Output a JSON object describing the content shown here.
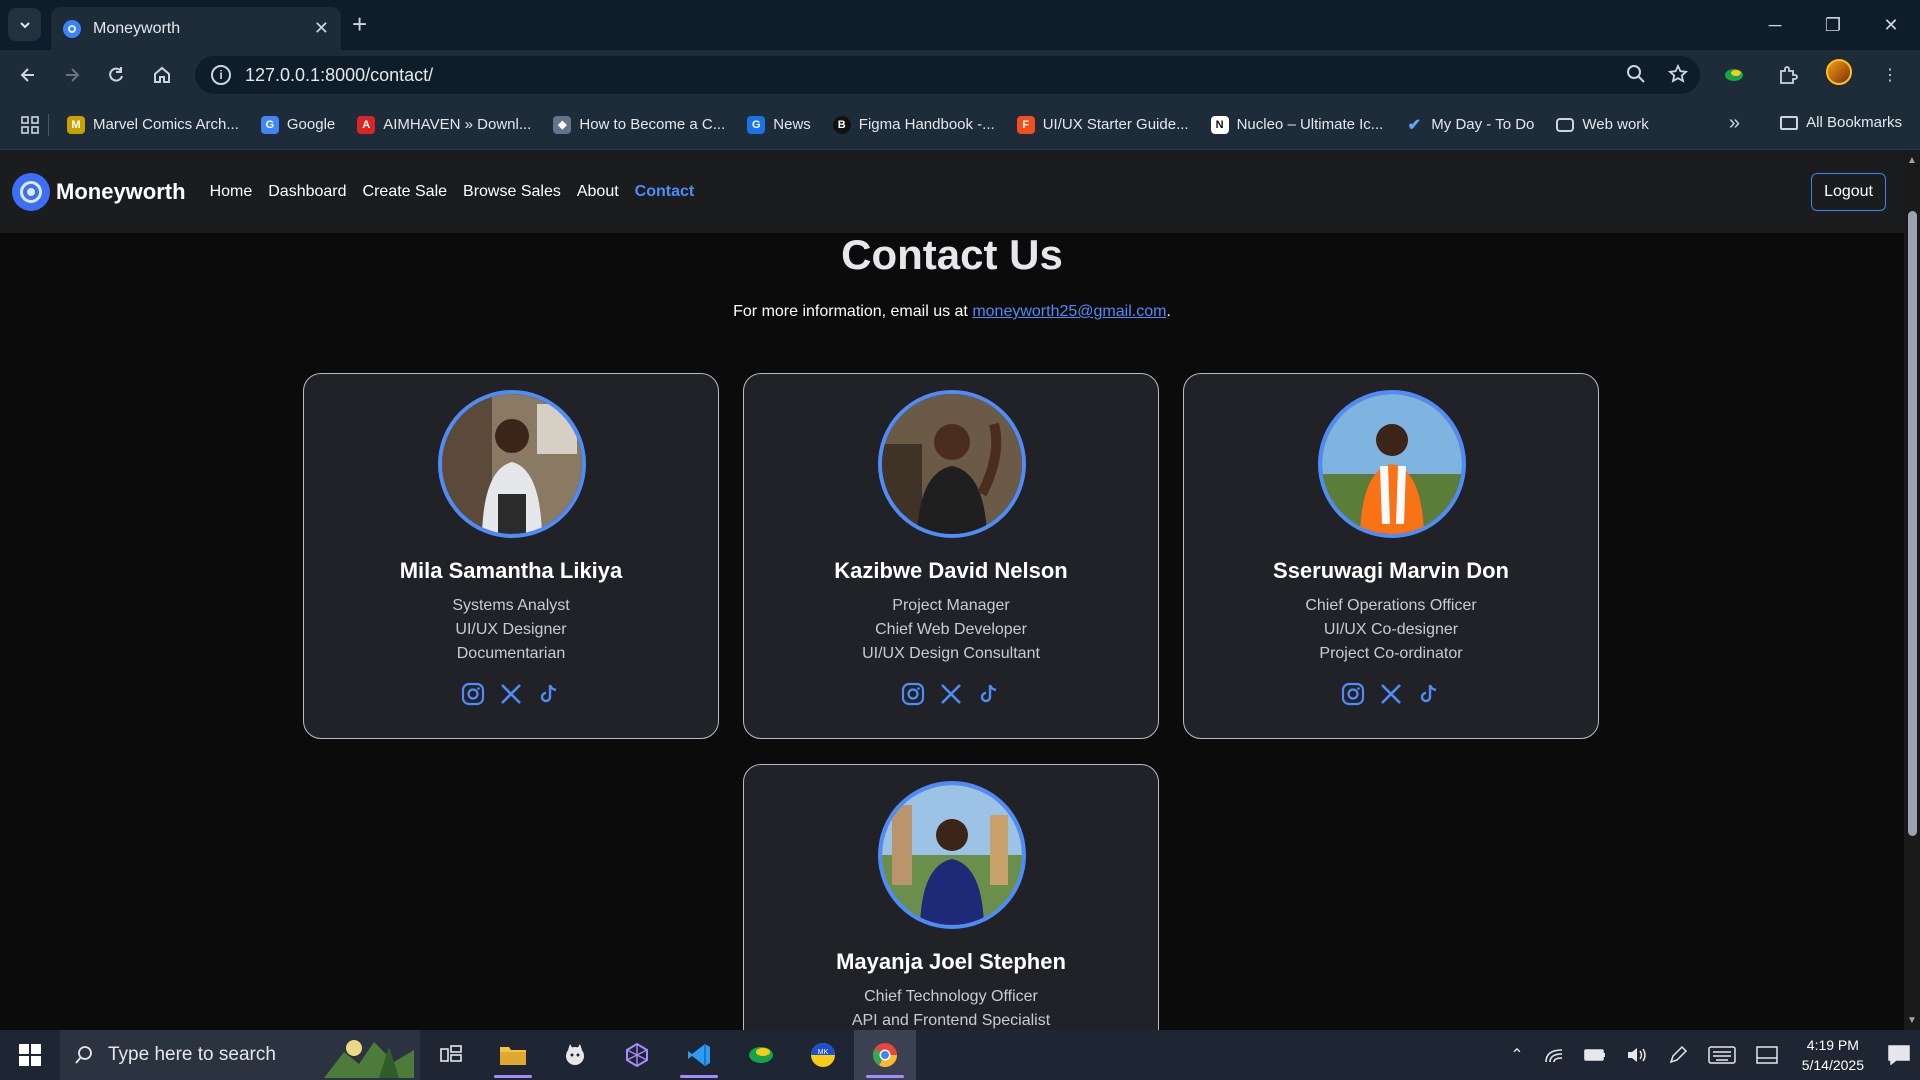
{
  "browser": {
    "tab_title": "Moneyworth",
    "url": "127.0.0.1:8000/contact/",
    "bookmarks": [
      {
        "label": "Marvel Comics Arch...",
        "color": "#c7a200"
      },
      {
        "label": "Google",
        "color": "#4285f4"
      },
      {
        "label": "AIMHAVEN » Downl...",
        "color": "#dc2626"
      },
      {
        "label": "How to Become a C...",
        "color": "#64748b"
      },
      {
        "label": "News",
        "color": "#1a73e8"
      },
      {
        "label": "Figma Handbook -...",
        "color": "#111111"
      },
      {
        "label": "UI/UX Starter Guide...",
        "color": "#f24e1e"
      },
      {
        "label": "Nucleo – Ultimate Ic...",
        "color": "#111111"
      },
      {
        "label": "My Day - To Do",
        "color": "#2563eb"
      },
      {
        "label": "Web work",
        "color": "#cbd5e1"
      }
    ],
    "all_bookmarks": "All Bookmarks"
  },
  "site": {
    "brand": "Moneyworth",
    "nav": [
      {
        "label": "Home",
        "active": false
      },
      {
        "label": "Dashboard",
        "active": false
      },
      {
        "label": "Create Sale",
        "active": false
      },
      {
        "label": "Browse Sales",
        "active": false
      },
      {
        "label": "About",
        "active": false
      },
      {
        "label": "Contact",
        "active": true
      }
    ],
    "logout": "Logout"
  },
  "contact": {
    "title": "Contact Us",
    "info_prefix": "For more information, email us at ",
    "email": "moneyworth25@gmail.com",
    "info_suffix": "."
  },
  "team": [
    {
      "name": "Mila Samantha Likiya",
      "roles": [
        "Systems Analyst",
        "UI/UX Designer",
        "Documentarian"
      ]
    },
    {
      "name": "Kazibwe David Nelson",
      "roles": [
        "Project Manager",
        "Chief Web Developer",
        "UI/UX Design Consultant"
      ]
    },
    {
      "name": "Sseruwagi Marvin Don",
      "roles": [
        "Chief Operations Officer",
        "UI/UX Co-designer",
        "Project Co-ordinator"
      ]
    },
    {
      "name": "Mayanja Joel Stephen",
      "roles": [
        "Chief Technology Officer",
        "API and Frontend Specialist"
      ]
    }
  ],
  "taskbar": {
    "search_placeholder": "Type here to search",
    "time": "4:19 PM",
    "date": "5/14/2025"
  },
  "colors": {
    "accent": "#4f8cf7",
    "card_bg": "#202227",
    "page_bg": "#0b0b0c"
  }
}
